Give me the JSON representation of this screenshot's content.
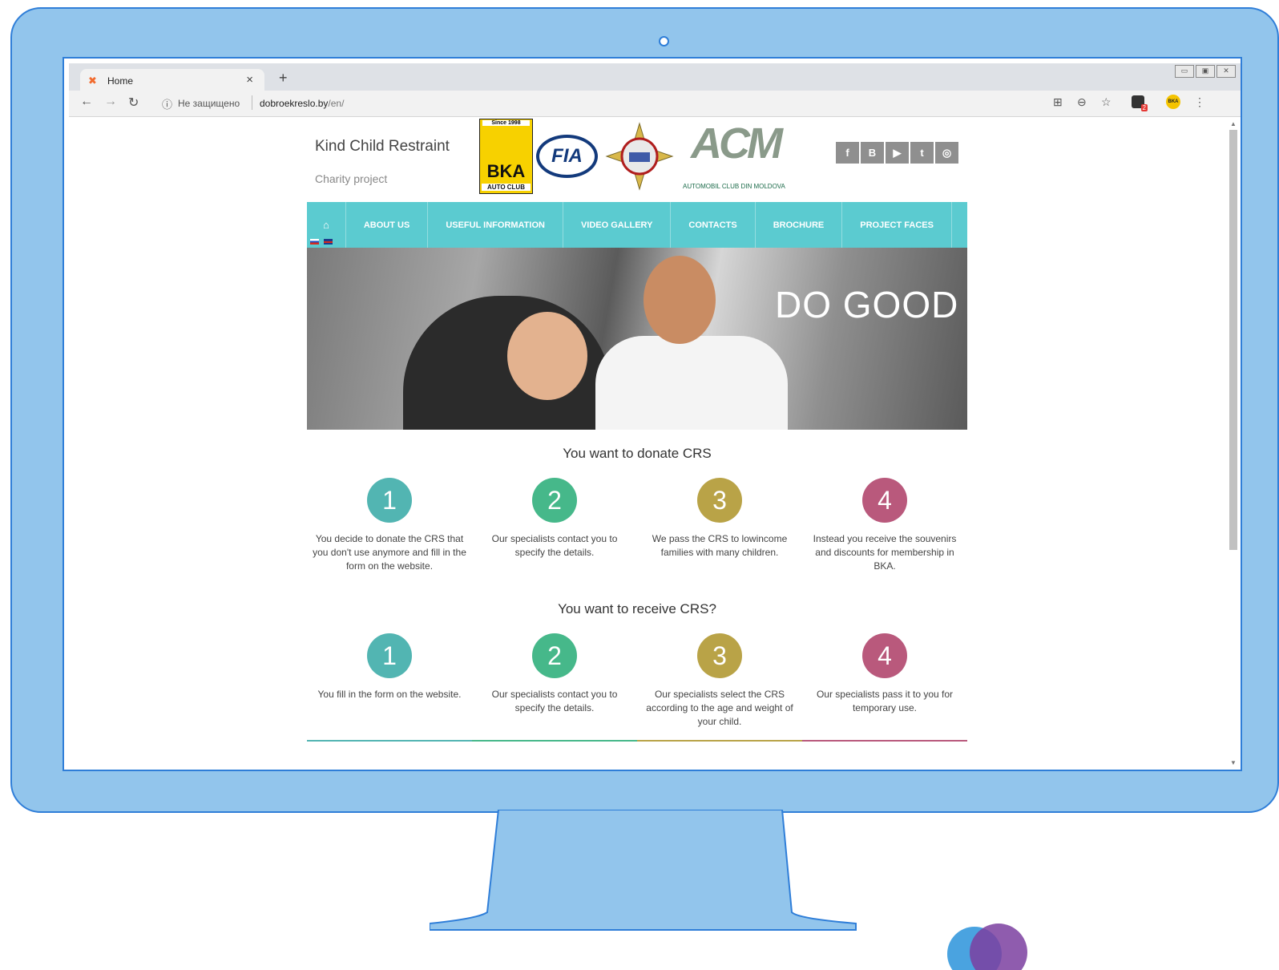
{
  "browser": {
    "tab_title": "Home",
    "security_label": "Не защищено",
    "url_domain": "dobroekreslo.by",
    "url_path": "/en/",
    "ext_badge_count": "2",
    "ext_bka_label": "BKA"
  },
  "site": {
    "brand": "Kind Child Restraint",
    "tagline": "Charity project",
    "partners": {
      "bka_since": "Since 1998",
      "bka_name": "BKA",
      "bka_sub": "AUTO CLUB",
      "fia": "FIA",
      "acm_mark": "ACM",
      "acm_sub": "AUTOMOBIL CLUB DIN MOLDOVA"
    },
    "social": [
      "f",
      "B",
      "▶",
      "t",
      "◎"
    ],
    "menu": [
      "ABOUT US",
      "USEFUL INFORMATION",
      "VIDEO GALLERY",
      "CONTACTS",
      "BROCHURE",
      "PROJECT FACES"
    ],
    "hero_headline": "DO GOOD",
    "donate": {
      "title": "You want to donate CRS",
      "steps": [
        {
          "num": "1",
          "text": "You decide to donate the CRS that you don't use anymore and fill in the form on the website."
        },
        {
          "num": "2",
          "text": "Our specialists contact you to specify the details."
        },
        {
          "num": "3",
          "text": "We pass the CRS to lowincome families with many children."
        },
        {
          "num": "4",
          "text": "Instead you receive the souvenirs and discounts for membership in BKA."
        }
      ]
    },
    "receive": {
      "title": "You want to receive CRS?",
      "steps": [
        {
          "num": "1",
          "text": "You fill in the form on the website."
        },
        {
          "num": "2",
          "text": "Our specialists contact you to specify the details."
        },
        {
          "num": "3",
          "text": "Our specialists select the CRS according to the age and weight of your child."
        },
        {
          "num": "4",
          "text": "Our specialists pass it to you for temporary use."
        }
      ]
    }
  },
  "colors": {
    "step1": "#52b5b2",
    "step2": "#46b88a",
    "step3": "#b9a347",
    "step4": "#b9597c",
    "menu": "#5bcbd0",
    "monitor": "#92c5ec"
  }
}
